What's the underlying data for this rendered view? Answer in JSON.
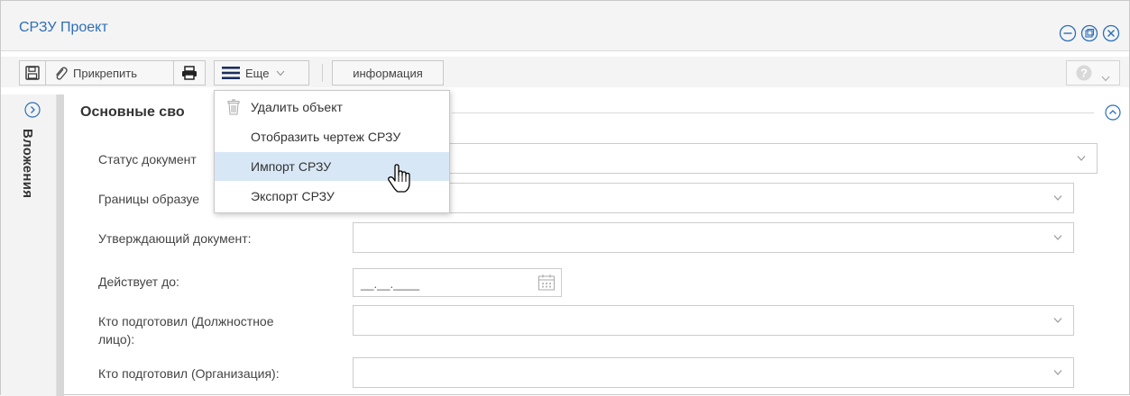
{
  "window": {
    "title": "СРЗУ Проект",
    "controls": [
      "minimize-icon",
      "restore-icon",
      "close-icon"
    ],
    "accent_color": "#2d6fb8"
  },
  "toolbar": {
    "attach_label": "Прикрепить",
    "more_label": "Еще",
    "info_label": "информация"
  },
  "menu": {
    "items": [
      {
        "label": "Удалить объект",
        "icon": "trash-icon"
      },
      {
        "label": "Отобразить чертеж СРЗУ"
      },
      {
        "label": "Импорт СРЗУ",
        "highlighted": true
      },
      {
        "label": "Экспорт СРЗУ"
      }
    ],
    "highlight_color": "#d8e7f5"
  },
  "sidebar": {
    "label": "Вложения"
  },
  "section": {
    "title": "Основные сво"
  },
  "form": {
    "status_label": "Статус документ",
    "borders_label": "Границы образуе",
    "approving_label": "Утверждающий документ:",
    "valid_until_label": "Действует до:",
    "valid_until_value": "__.__.____",
    "prepared_person_label_1": "Кто подготовил (Должностное",
    "prepared_person_label_2": "лицо):",
    "prepared_org_label": "Кто подготовил (Организация):"
  }
}
